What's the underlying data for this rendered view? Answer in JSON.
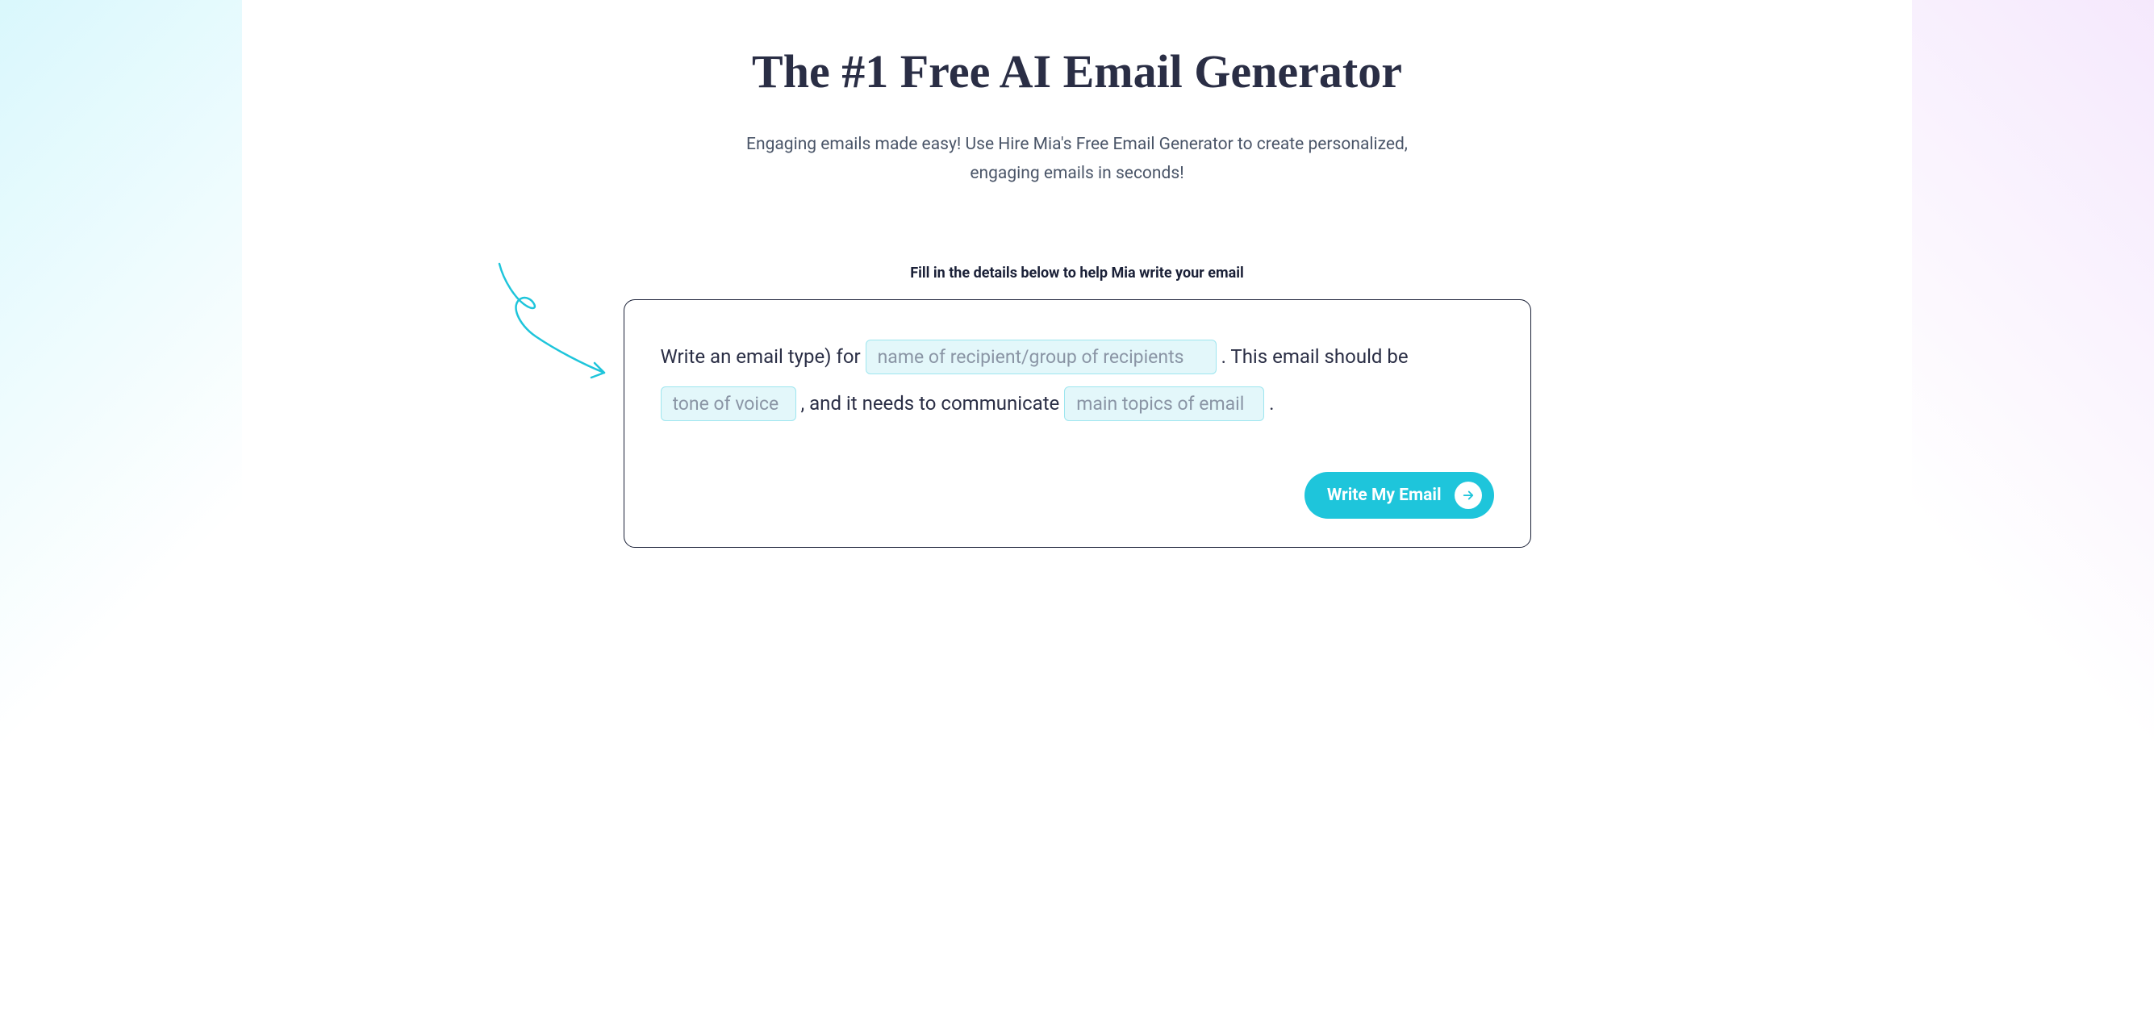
{
  "heading": "The #1 Free AI Email Generator",
  "subheading": "Engaging emails made easy! Use Hire Mia's Free Email Generator to create personalized, engaging emails in seconds!",
  "form": {
    "label": "Fill in the details below to help Mia write your email",
    "text_part_1": "Write an email type) for ",
    "text_part_2": " . This email should be ",
    "text_part_3": " , and it needs to communicate ",
    "text_part_4": " .",
    "inputs": {
      "recipient": {
        "value": "",
        "placeholder": "name of recipient/group of recipients"
      },
      "tone": {
        "value": "",
        "placeholder": "tone of voice"
      },
      "topics": {
        "value": "",
        "placeholder": "main topics of email"
      }
    },
    "button_label": "Write My Email"
  },
  "colors": {
    "accent": "#1ec5db",
    "text_primary": "#2a2e45",
    "text_secondary": "#4a5568",
    "input_bg": "#e3f7fa",
    "input_border": "#9ee6ef"
  }
}
